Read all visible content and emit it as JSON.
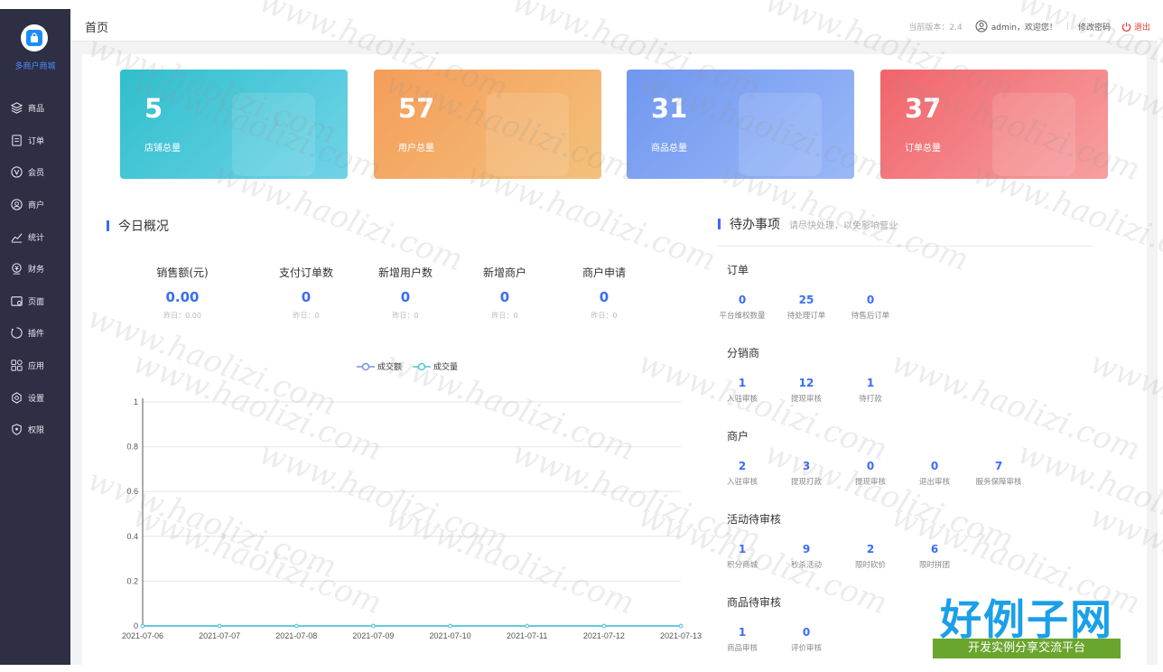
{
  "sidebar": {
    "brand": "多商户商城",
    "items": [
      {
        "label": "商品",
        "icon": "layers-icon"
      },
      {
        "label": "订单",
        "icon": "order-icon"
      },
      {
        "label": "会员",
        "icon": "member-icon"
      },
      {
        "label": "商户",
        "icon": "merchant-icon"
      },
      {
        "label": "统计",
        "icon": "chart-line-icon"
      },
      {
        "label": "财务",
        "icon": "finance-icon"
      },
      {
        "label": "页面",
        "icon": "page-icon"
      },
      {
        "label": "插件",
        "icon": "plugin-icon"
      },
      {
        "label": "应用",
        "icon": "apps-icon"
      },
      {
        "label": "设置",
        "icon": "settings-icon"
      },
      {
        "label": "权限",
        "icon": "shield-icon"
      }
    ]
  },
  "header": {
    "title": "首页",
    "version": "当前版本：2.4",
    "user": "admin，欢迎您！",
    "change_password": "修改密码",
    "logout": "退出"
  },
  "cards": [
    {
      "value": "5",
      "label": "店铺总量",
      "color": "#36c0d0"
    },
    {
      "value": "57",
      "label": "用户总量",
      "color": "#f0a35e"
    },
    {
      "value": "31",
      "label": "商品总量",
      "color": "#7ba0f3"
    },
    {
      "value": "37",
      "label": "订单总量",
      "color": "#f06b70"
    }
  ],
  "today": {
    "title": "今日概况",
    "stats": [
      {
        "title": "销售额(元)",
        "value": "0.00",
        "yesterday": "昨日：0.00"
      },
      {
        "title": "支付订单数",
        "value": "0",
        "yesterday": "昨日：0"
      },
      {
        "title": "新增用户数",
        "value": "0",
        "yesterday": "昨日：0"
      },
      {
        "title": "新增商户",
        "value": "0",
        "yesterday": "昨日：0"
      },
      {
        "title": "商户申请",
        "value": "0",
        "yesterday": "昨日：0"
      }
    ]
  },
  "chart_data": {
    "type": "line",
    "x": [
      "2021-07-06",
      "2021-07-07",
      "2021-07-08",
      "2021-07-09",
      "2021-07-10",
      "2021-07-11",
      "2021-07-12",
      "2021-07-13"
    ],
    "series": [
      {
        "name": "成交额",
        "values": [
          0,
          0,
          0,
          0,
          0,
          0,
          0,
          0
        ],
        "color": "#7b8fe0"
      },
      {
        "name": "成交量",
        "values": [
          0,
          0,
          0,
          0,
          0,
          0,
          0,
          0
        ],
        "color": "#4cc9d6"
      }
    ],
    "yticks": [
      "0",
      "0.2",
      "0.4",
      "0.6",
      "0.8",
      "1"
    ],
    "ylim": [
      0,
      1
    ],
    "grid": true,
    "legend": "top"
  },
  "todo": {
    "title": "待办事项",
    "subtitle": "请尽快处理，以免影响营业",
    "groups": [
      {
        "title": "订单",
        "items": [
          {
            "value": "0",
            "label": "平台维权数量"
          },
          {
            "value": "25",
            "label": "待处理订单"
          },
          {
            "value": "0",
            "label": "待售后订单"
          }
        ]
      },
      {
        "title": "分销商",
        "items": [
          {
            "value": "1",
            "label": "入驻审核"
          },
          {
            "value": "12",
            "label": "提现审核"
          },
          {
            "value": "1",
            "label": "待打款"
          }
        ]
      },
      {
        "title": "商户",
        "items": [
          {
            "value": "2",
            "label": "入驻审核"
          },
          {
            "value": "3",
            "label": "提现打款"
          },
          {
            "value": "0",
            "label": "提现审核"
          },
          {
            "value": "0",
            "label": "退出审核"
          },
          {
            "value": "7",
            "label": "服务保障审核"
          }
        ]
      },
      {
        "title": "活动待审核",
        "items": [
          {
            "value": "1",
            "label": "积分商城"
          },
          {
            "value": "9",
            "label": "秒杀活动"
          },
          {
            "value": "2",
            "label": "限时砍价"
          },
          {
            "value": "6",
            "label": "限时拼团"
          }
        ]
      },
      {
        "title": "商品待审核",
        "items": [
          {
            "value": "1",
            "label": "商品审核"
          },
          {
            "value": "0",
            "label": "评价审核"
          }
        ]
      }
    ]
  },
  "watermark": "www.haolizi.com",
  "badge": {
    "big": "好例子网",
    "small": "开发实例分享交流平台"
  }
}
